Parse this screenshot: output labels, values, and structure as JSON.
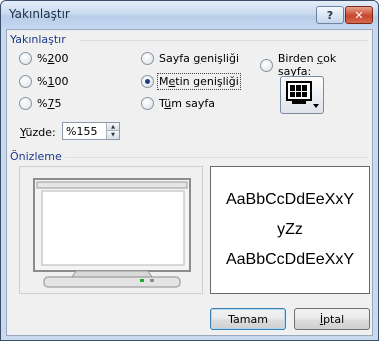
{
  "window": {
    "title": "Yakınlaştır"
  },
  "titlebar": {
    "help_label": "?",
    "close_label": "✕"
  },
  "zoom_group": {
    "label": "Yakınlaştır"
  },
  "options": {
    "z200": {
      "label_pre": "%",
      "label_u": "2",
      "label_post": "00",
      "checked": false
    },
    "z100": {
      "label_pre": "%",
      "label_u": "1",
      "label_post": "00",
      "checked": false
    },
    "z75": {
      "label_pre": "%",
      "label_u": "7",
      "label_post": "5",
      "checked": false
    },
    "page_width": {
      "label_pre": "Sayfa ",
      "label_u": "g",
      "label_post": "enişliği",
      "checked": false
    },
    "text_width": {
      "label_pre": "M",
      "label_u": "e",
      "label_post": "tin genişliği",
      "checked": true
    },
    "whole_page": {
      "label_pre": "T",
      "label_u": "ü",
      "label_post": "m sayfa",
      "checked": false
    },
    "many_pages": {
      "label_pre": "Birden ",
      "label_u": "ç",
      "label_post": "ok sayfa:",
      "checked": false
    }
  },
  "percent": {
    "label_u": "Y",
    "label_post": "üzde:",
    "value": "%155"
  },
  "preview_group": {
    "label": "Önizleme"
  },
  "sample": {
    "line1": "AaBbCcDdEeXxY",
    "line2": "yZz",
    "line3": "AaBbCcDdEeXxY"
  },
  "buttons": {
    "ok": "Tamam",
    "cancel_u": "İ",
    "cancel_post": "ptal"
  },
  "colors": {
    "group_label": "#1a3a8a",
    "selected_radio": "#1b3b8b",
    "default_button_border": "#3c7fb1"
  }
}
